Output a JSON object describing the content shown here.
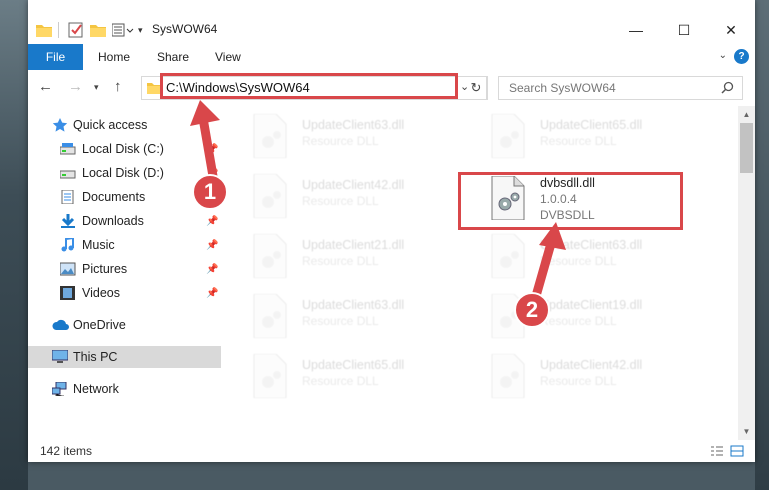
{
  "window": {
    "title": "SysWOW64",
    "controls": {
      "minimize": "—",
      "maximize": "☐",
      "close": "✕"
    }
  },
  "ribbon": {
    "tabs": [
      "File",
      "Home",
      "Share",
      "View"
    ],
    "help": "?"
  },
  "address": {
    "path": "C:\\Windows\\SysWOW64",
    "search_placeholder": "Search SysWOW64"
  },
  "nav": {
    "items": [
      {
        "label": "Quick access",
        "icon": "star-icon",
        "pinned": false
      },
      {
        "label": "Local Disk (C:)",
        "icon": "drive-icon",
        "pinned": true
      },
      {
        "label": "Local Disk (D:)",
        "icon": "drive-icon",
        "pinned": true
      },
      {
        "label": "Documents",
        "icon": "documents-icon",
        "pinned": true
      },
      {
        "label": "Downloads",
        "icon": "downloads-icon",
        "pinned": true
      },
      {
        "label": "Music",
        "icon": "music-icon",
        "pinned": true
      },
      {
        "label": "Pictures",
        "icon": "pictures-icon",
        "pinned": true
      },
      {
        "label": "Videos",
        "icon": "videos-icon",
        "pinned": true
      },
      {
        "label": "OneDrive",
        "icon": "onedrive-icon",
        "pinned": false
      },
      {
        "label": "This PC",
        "icon": "pc-icon",
        "pinned": false,
        "selected": true
      },
      {
        "label": "Network",
        "icon": "network-icon",
        "pinned": false
      }
    ]
  },
  "files": [
    {
      "name": "UpdateClient63.dll",
      "desc": "Resource DLL"
    },
    {
      "name": "UpdateClient65.dll",
      "desc": "Resource DLL"
    },
    {
      "name": "UpdateClient42.dll",
      "desc": "Resource DLL"
    },
    {
      "name": "UpdateClient21.dll",
      "desc": "Resource DLL"
    },
    {
      "name": "UpdateClient63.dll",
      "desc": "Resource DLL"
    },
    {
      "name": "UpdateClient63.dll",
      "desc": "Resource DLL"
    },
    {
      "name": "UpdateClient19.dll",
      "desc": "Resource DLL"
    },
    {
      "name": "UpdateClient65.dll",
      "desc": "Resource DLL"
    },
    {
      "name": "UpdateClient42.dll",
      "desc": "Resource DLL"
    }
  ],
  "highlighted_file": {
    "name": "dvbsdll.dll",
    "version": "1.0.0.4",
    "desc": "DVBSDLL"
  },
  "status": {
    "count": "142 items"
  },
  "callouts": [
    "1",
    "2"
  ],
  "colors": {
    "accent": "#1979ca",
    "highlight": "#d9474a"
  }
}
